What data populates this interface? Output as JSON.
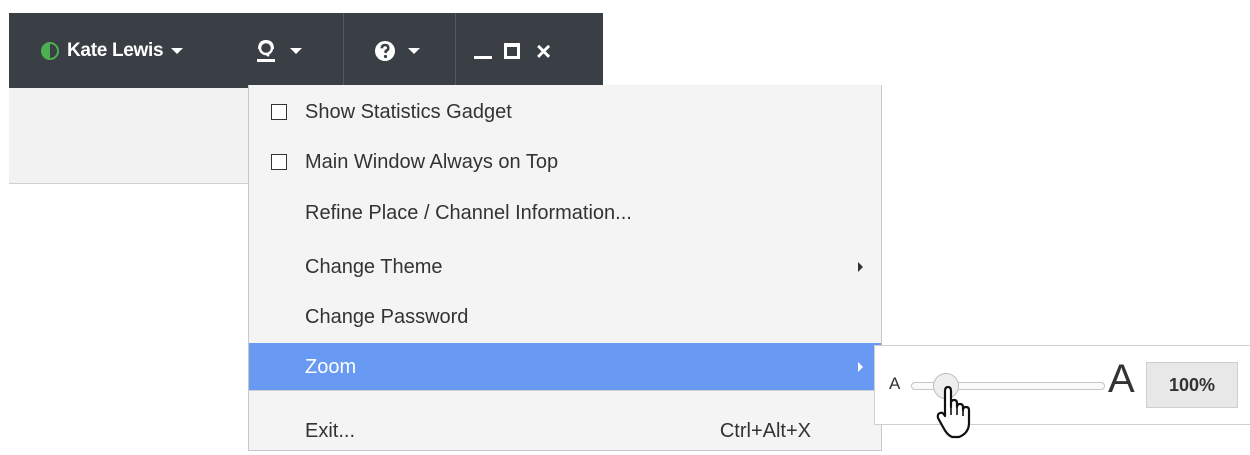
{
  "topbar": {
    "user_name": "Kate Lewis",
    "status_color": "#4caf50",
    "icons": [
      "status-icon",
      "agent-icon",
      "help-icon",
      "minimize-icon",
      "maximize-icon",
      "close-icon"
    ],
    "background": "#3a3f45"
  },
  "menu": {
    "items": [
      {
        "label": "Show Statistics Gadget",
        "checkbox": true,
        "checked": false
      },
      {
        "label": "Main Window Always on Top",
        "checkbox": true,
        "checked": false
      },
      {
        "label": "Refine Place / Channel Information..."
      },
      {
        "label": "Change Theme",
        "submenu": true
      },
      {
        "label": "Change Password"
      },
      {
        "label": "Zoom",
        "submenu": true,
        "active": true
      },
      {
        "label": "Exit...",
        "shortcut": "Ctrl+Alt+X"
      }
    ],
    "active_color": "#6899f3"
  },
  "zoom": {
    "small_label": "A",
    "large_label": "A",
    "value_label": "100%",
    "slider_position": 0.15
  }
}
